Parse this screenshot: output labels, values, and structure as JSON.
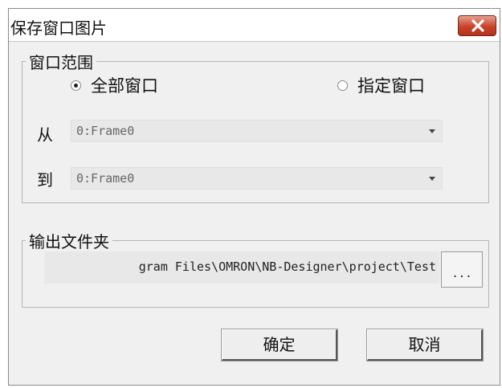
{
  "window": {
    "title": "保存窗口图片"
  },
  "range": {
    "legend": "窗口范围",
    "options": [
      "全部窗口",
      "指定窗口"
    ],
    "selected_option": "全部窗口",
    "from_label": "从",
    "from_value": "0:Frame0",
    "to_label": "到",
    "to_value": "0:Frame0"
  },
  "output": {
    "legend": "输出文件夹",
    "path_visible": "gram Files\\OMRON\\NB-Designer\\project\\Test",
    "browse_label": "..."
  },
  "buttons": {
    "ok": "确定",
    "cancel": "取消"
  },
  "colors": {
    "close_button": "#c8432a",
    "dialog_bg": "#f0f0f0",
    "field_bg": "#e8e8e8"
  },
  "icons": {
    "close": "close-x-icon",
    "dropdown": "chevron-down-icon"
  }
}
